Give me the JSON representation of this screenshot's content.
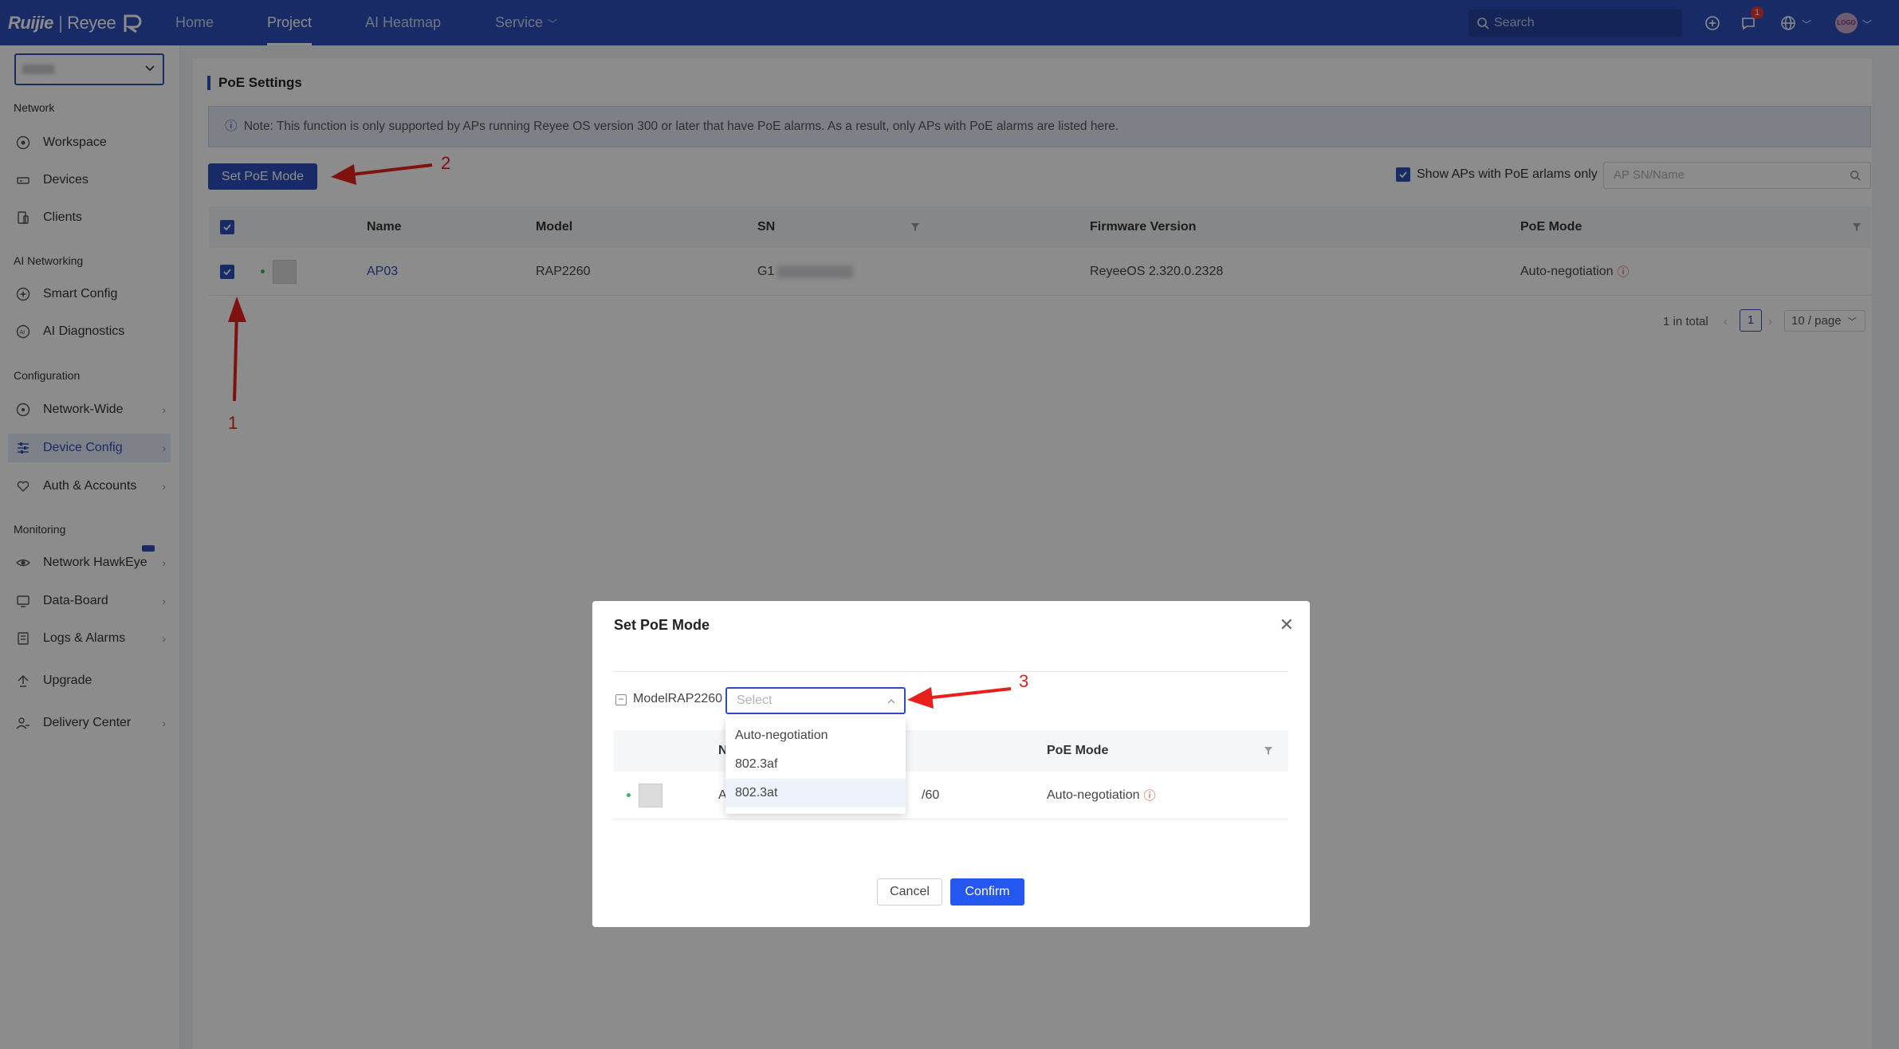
{
  "topbar": {
    "logo_brand": "Ruijie",
    "logo_product": "Reyee",
    "nav": [
      "Home",
      "Project",
      "AI Heatmap",
      "Service"
    ],
    "active_nav": "Project",
    "search_placeholder": "Search",
    "notification_count": "1",
    "avatar_text": "LOGO"
  },
  "sidebar": {
    "groups": {
      "network": "Network",
      "ai": "AI Networking",
      "configuration": "Configuration",
      "monitoring": "Monitoring"
    },
    "items": {
      "workspace": "Workspace",
      "devices": "Devices",
      "clients": "Clients",
      "smart_config": "Smart Config",
      "ai_diagnostics": "AI Diagnostics",
      "network_wide": "Network-Wide",
      "device_config": "Device Config",
      "auth_accounts": "Auth & Accounts",
      "hawkeye": "Network HawkEye",
      "data_board": "Data-Board",
      "logs_alarms": "Logs & Alarms",
      "upgrade": "Upgrade",
      "delivery_center": "Delivery Center"
    },
    "active_item": "Device Config"
  },
  "main": {
    "title": "PoE Settings",
    "note": "Note: This function is only supported by APs running Reyee OS version 300 or later that have PoE alarms. As a result, only APs with PoE alarms are listed here.",
    "set_poe_button": "Set PoE Mode",
    "show_alarms_label": "Show APs with PoE arlams only",
    "search_placeholder": "AP SN/Name",
    "table": {
      "headers": [
        "Name",
        "Model",
        "SN",
        "Firmware Version",
        "PoE Mode"
      ],
      "rows": [
        {
          "name": "AP03",
          "model": "RAP2260",
          "sn": "G1",
          "firmware": "ReyeeOS 2.320.0.2328",
          "poe_mode": "Auto-negotiation"
        }
      ]
    },
    "pagination": {
      "total": "1 in total",
      "current_page": "1",
      "page_size": "10 / page"
    }
  },
  "modal": {
    "title": "Set PoE Mode",
    "model_label": "ModelRAP2260",
    "select_placeholder": "Select",
    "options": [
      "Auto-negotiation",
      "802.3af",
      "802.3at"
    ],
    "hovered_option": "802.3at",
    "table": {
      "headers": {
        "name": "N",
        "poe_mode": "PoE Mode"
      },
      "row": {
        "name": "A",
        "model_suffix": "/60",
        "poe_mode": "Auto-negotiation"
      }
    },
    "cancel": "Cancel",
    "confirm": "Confirm"
  },
  "annotations": [
    "1",
    "2",
    "3"
  ],
  "colors": {
    "brand": "#2c4fba",
    "confirm": "#2457f0",
    "annotation": "#e8201c",
    "warning": "#e53935"
  }
}
